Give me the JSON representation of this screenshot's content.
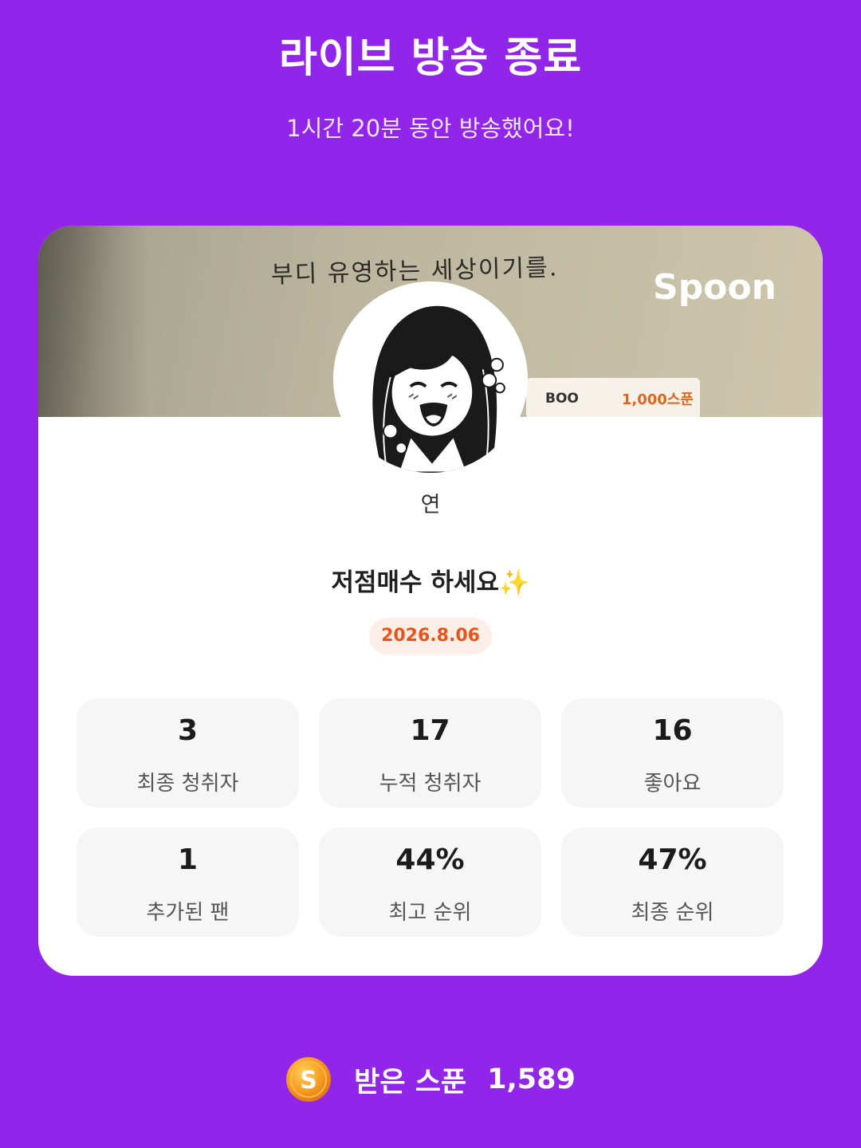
{
  "header": {
    "title": "라이브 방송 종료",
    "subtitle": "1시간 20분 동안 방송했어요!"
  },
  "card": {
    "banner": {
      "caption": "부디 유영하는 세상이기를.",
      "brand": "Spoon",
      "tag_user": "BOO",
      "tag_amount": "1,000스푼"
    },
    "nickname": "연",
    "broadcast_title": "저점매수 하세요✨",
    "date": "2026.8.06",
    "stats": [
      {
        "value": "3",
        "label": "최종 청취자"
      },
      {
        "value": "17",
        "label": "누적 청취자"
      },
      {
        "value": "16",
        "label": "좋아요"
      },
      {
        "value": "1",
        "label": "추가된 팬"
      },
      {
        "value": "44%",
        "label": "최고 순위"
      },
      {
        "value": "47%",
        "label": "최종 순위"
      }
    ]
  },
  "footer": {
    "coin_letter": "S",
    "label": "받은 스푼",
    "value": "1,589"
  },
  "colors": {
    "background": "#9125e9",
    "accent_orange": "#e8541a",
    "coin": "#f59a1f"
  }
}
